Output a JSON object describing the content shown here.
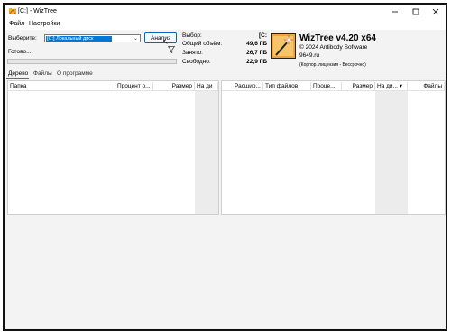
{
  "window": {
    "title": "[C:] - WizTree",
    "menu": [
      "Файл",
      "Настройки"
    ]
  },
  "top": {
    "select_label": "Выберите:",
    "drive_value": "[C:] Локальный диск",
    "analyze_label": "Анализ",
    "status": "Готово...",
    "stats": [
      {
        "label": "Выбор:",
        "value": "[C:"
      },
      {
        "label": "Общий объём:",
        "value": "49,6 ГБ"
      },
      {
        "label": "Занято:",
        "value": "26,7 ГБ"
      },
      {
        "label": "Свободно:",
        "value": "22,9 ГБ"
      }
    ],
    "accent": "#0078d7"
  },
  "banner": {
    "app_name": "WizTree v4.20 x64",
    "copyright": "© 2024 Antibody Software",
    "site": "9649.ru",
    "license": "(Корпор. лицензия - Бессрочно)"
  },
  "tabs": [
    "Дерево",
    "Файлы",
    "О программе"
  ],
  "tree_columns": [
    "Папка",
    "Процент о...",
    "Размер",
    "На ди"
  ],
  "files_columns": [
    "Расшир...",
    "Тип файлов",
    "Проце...",
    "Размер",
    "На ди...",
    "Файлы"
  ]
}
